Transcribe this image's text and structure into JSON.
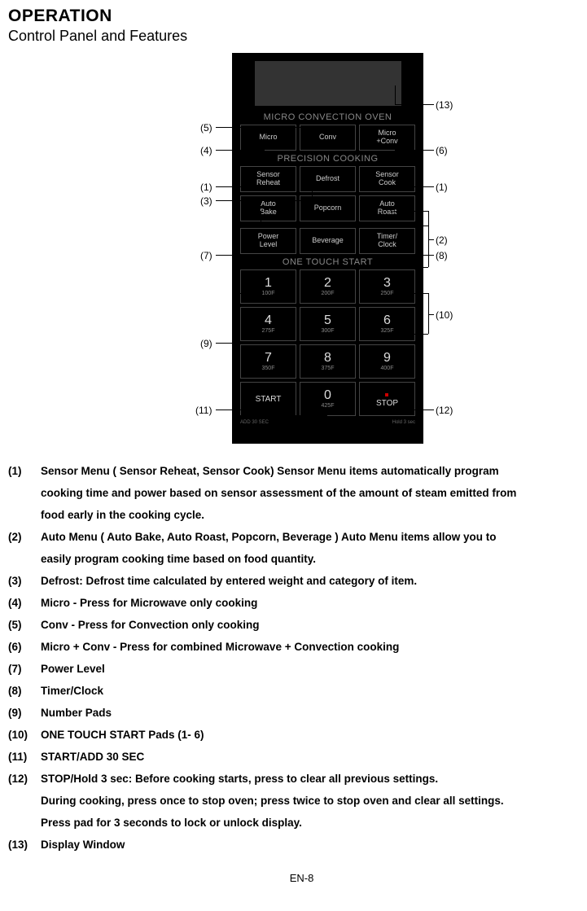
{
  "title": "OPERATION",
  "subtitle": "Control Panel and Features",
  "panel": {
    "section1": "MICRO CONVECTION OVEN",
    "mode": {
      "micro": "Micro",
      "conv": "Conv",
      "micro_conv_top": "Micro",
      "micro_conv_bot": "+Conv"
    },
    "section2": "PRECISION COOKING",
    "prec": {
      "sensor_reheat_top": "Sensor",
      "sensor_reheat_bot": "Reheat",
      "defrost": "Defrost",
      "sensor_cook_top": "Sensor",
      "sensor_cook_bot": "Cook",
      "auto_bake_top": "Auto",
      "auto_bake_bot": "Bake",
      "popcorn": "Popcorn",
      "auto_roast_top": "Auto",
      "auto_roast_bot": "Roast"
    },
    "r3": {
      "power_top": "Power",
      "power_bot": "Level",
      "beverage": "Beverage",
      "timer_top": "Timer/",
      "timer_bot": "Clock"
    },
    "section3": "ONE TOUCH START",
    "keys": [
      {
        "n": "1",
        "s": "100F"
      },
      {
        "n": "2",
        "s": "200F"
      },
      {
        "n": "3",
        "s": "250F"
      },
      {
        "n": "4",
        "s": "275F"
      },
      {
        "n": "5",
        "s": "300F"
      },
      {
        "n": "6",
        "s": "325F"
      },
      {
        "n": "7",
        "s": "350F"
      },
      {
        "n": "8",
        "s": "375F"
      },
      {
        "n": "9",
        "s": "400F"
      }
    ],
    "start": "START",
    "start_sub": "ADD 30 SEC",
    "zero": "0",
    "zero_sub": "425F",
    "stop": "STOP",
    "stop_sub": "Hold 3 sec"
  },
  "annot": {
    "l1": "(1)",
    "l2": "(2)",
    "l3": "(3)",
    "l4": "(4)",
    "l5": "(5)",
    "l6": "(6)",
    "l7": "(7)",
    "l8": "(8)",
    "l9": "(9)",
    "l10": "(10)",
    "l11": "(11)",
    "l12": "(12)",
    "l13": "(13)"
  },
  "desc": {
    "d1n": "(1)",
    "d1a": "Sensor Menu ( Sensor Reheat, Sensor Cook) Sensor Menu items automatically program",
    "d1b": "cooking time and power based on sensor assessment of the amount of steam emitted from",
    "d1c": "food early in the cooking cycle.",
    "d2n": "(2)",
    "d2a": "Auto Menu ( Auto Bake, Auto Roast, Popcorn, Beverage ) Auto Menu  items allow you to",
    "d2b": "easily program cooking time based on food quantity.",
    "d3n": "(3)",
    "d3t": "Defrost: Defrost time calculated by entered weight and category of item.",
    "d4n": "(4)",
    "d4t": "Micro - Press for Microwave only cooking",
    "d5n": "(5)",
    "d5t": "Conv - Press for Convection only cooking",
    "d6n": "(6)",
    "d6t": "Micro + Conv - Press for combined Microwave + Convection cooking",
    "d7n": "(7)",
    "d7t": "Power Level",
    "d8n": "(8)",
    "d8t": "Timer/Clock",
    "d9n": "(9)",
    "d9t": "Number Pads",
    "d10n": "(10)",
    "d10t": "ONE TOUCH START Pads (1- 6)",
    "d11n": "(11)",
    "d11t": "START/ADD 30 SEC",
    "d12n": "(12)",
    "d12a": "STOP/Hold 3 sec: Before cooking starts, press to clear all previous settings.",
    "d12b": "During cooking, press once to stop oven; press twice to stop oven and clear all settings.",
    "d12c": "Press pad for 3 seconds to lock or unlock display.",
    "d13n": "(13)",
    "d13t": "Display Window"
  },
  "footer": "EN-8"
}
